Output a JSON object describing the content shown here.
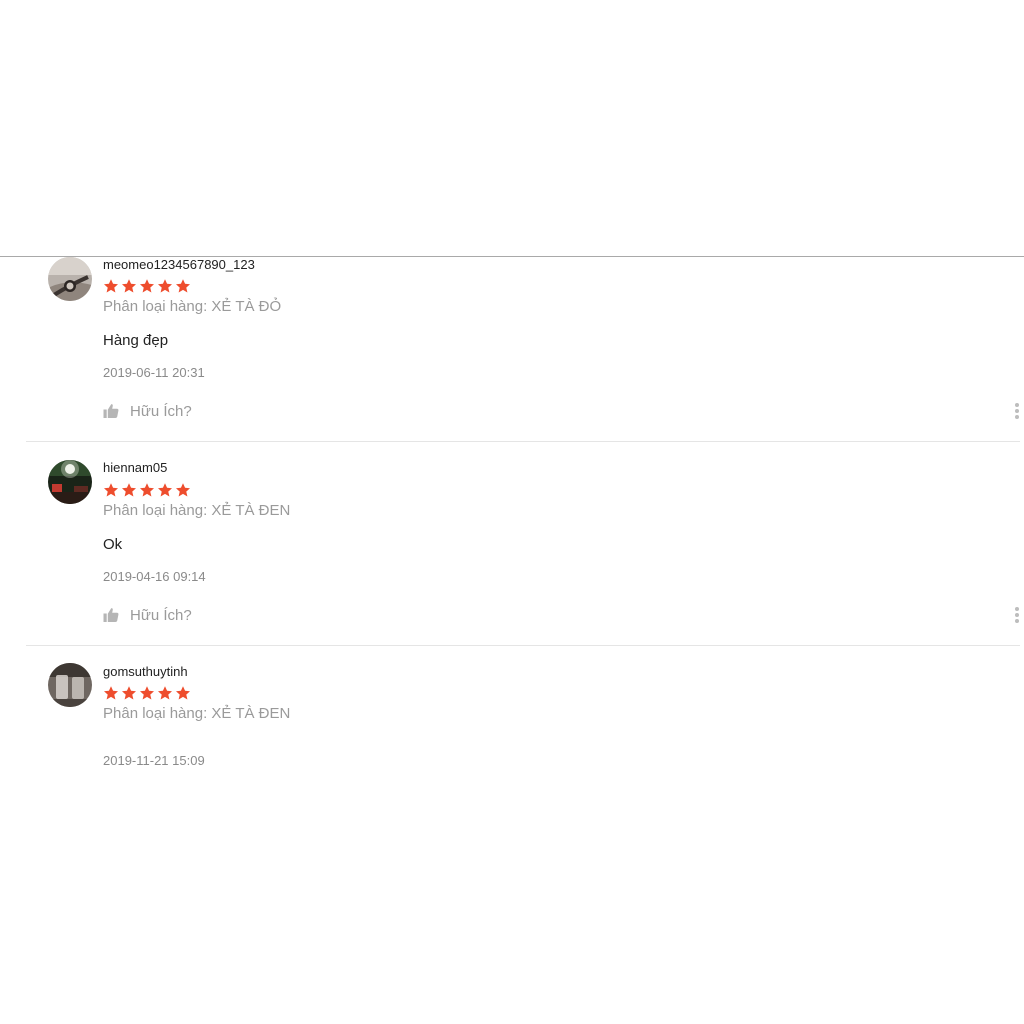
{
  "colors": {
    "star": "#ee4d2d",
    "muted_text": "#9a9a9a",
    "divider": "#e5e5e5"
  },
  "reviews": [
    {
      "username": "meomeo1234567890_123",
      "rating": 5,
      "variation": "Phân loại hàng: XẺ TÀ ĐỎ",
      "comment": "Hàng đẹp",
      "timestamp": "2019-06-11 20:31",
      "helpful_label": "Hữu Ích?",
      "avatar_icon": "avatar-wrist-watch-photo"
    },
    {
      "username": "hiennam05",
      "rating": 5,
      "variation": "Phân loại hàng: XẺ TÀ ĐEN",
      "comment": "Ok",
      "timestamp": "2019-04-16 09:14",
      "helpful_label": "Hữu Ích?",
      "avatar_icon": "avatar-night-street-photo"
    },
    {
      "username": "gomsuthuytinh",
      "rating": 5,
      "variation": "Phân loại hàng: XẺ TÀ ĐEN",
      "comment": "",
      "timestamp": "2019-11-21 15:09",
      "avatar_icon": "avatar-glassware-photo"
    }
  ]
}
